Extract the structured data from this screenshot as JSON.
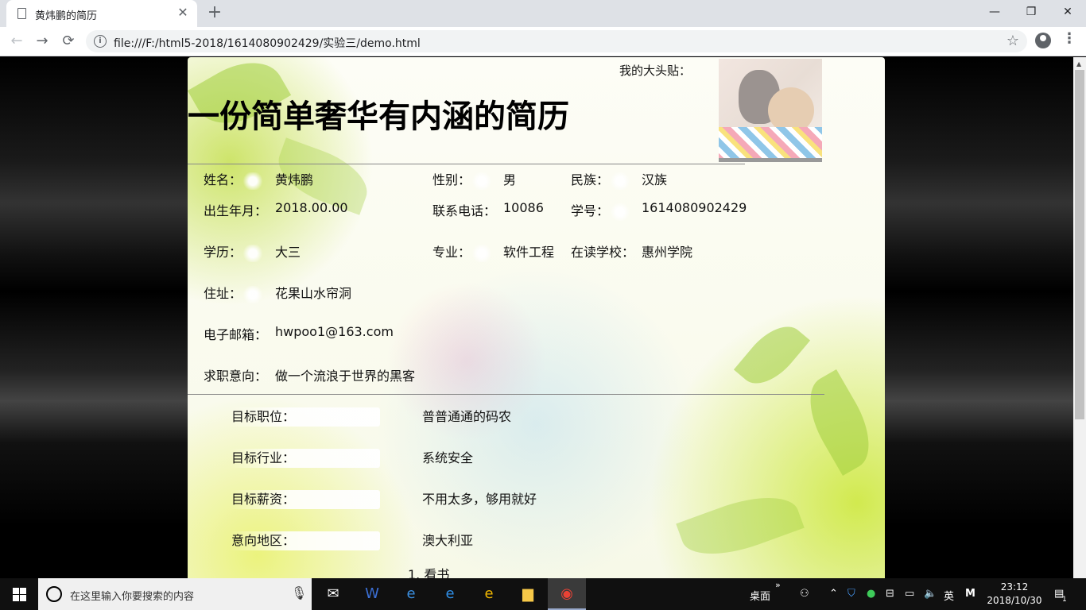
{
  "browser": {
    "tab_title": "黄炜鹏的简历",
    "tab_close": "✕",
    "new_tab": "+",
    "url": "file:///F:/html5-2018/1614080902429/实验三/demo.html",
    "window": {
      "minimize": "—",
      "restore": "❐",
      "close": "✕"
    },
    "nav": {
      "back": "←",
      "forward": "→",
      "reload": "⟳"
    }
  },
  "resume": {
    "photo_label": "我的大头贴：",
    "title": "一份简单奢华有内涵的简历",
    "fields": [
      {
        "label": "姓名：",
        "value": "黄炜鹏"
      },
      {
        "label": "性别：",
        "value": "男"
      },
      {
        "label": "民族：",
        "value": "汉族"
      },
      {
        "label": "出生年月：",
        "value": "2018.00.00"
      },
      {
        "label": "联系电话：",
        "value": "10086"
      },
      {
        "label": "学号：",
        "value": "1614080902429"
      },
      {
        "label": "学历：",
        "value": "大三"
      },
      {
        "label": "专业：",
        "value": "软件工程"
      },
      {
        "label": "在读学校：",
        "value": "惠州学院"
      },
      {
        "label": "住址：",
        "value": "花果山水帘洞"
      },
      {
        "label": "电子邮箱：",
        "value": "hwpoo1@163.com"
      },
      {
        "label": "求职意向：",
        "value": "做一个流浪于世界的黑客"
      }
    ],
    "goals": [
      {
        "label": "目标职位：",
        "value": "普普通通的码农"
      },
      {
        "label": "目标行业：",
        "value": "系统安全"
      },
      {
        "label": "目标薪资：",
        "value": "不用太多，够用就好"
      },
      {
        "label": "意向地区：",
        "value": "澳大利亚"
      }
    ],
    "hobby_item": "1. 看书"
  },
  "taskbar": {
    "search_placeholder": "在这里输入你要搜索的内容",
    "desktop_label": "桌面",
    "ime": "英",
    "clock_time": "23:12",
    "clock_date": "2018/10/30",
    "notification_count": "1"
  }
}
